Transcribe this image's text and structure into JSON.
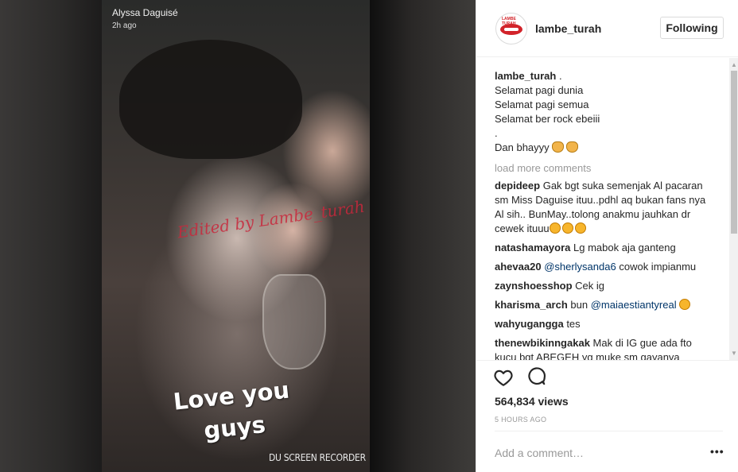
{
  "media": {
    "story_username": "Alyssa Daguisé",
    "story_time": "2h ago",
    "watermark": "Edited by Lambe_turah",
    "caption": "Love you guys",
    "recorder_label": "DU SCREEN RECORDER"
  },
  "header": {
    "avatar_brand": "LAMBE TURAH",
    "username": "lambe_turah",
    "follow_label": "Following"
  },
  "caption": {
    "username": "lambe_turah",
    "first_line": ".",
    "lines": [
      "Selamat pagi dunia",
      "Selamat pagi semua",
      "Selamat ber rock ebeiii",
      "."
    ],
    "last_line": "Dan bhayyy"
  },
  "load_more": "load more comments",
  "comments": [
    {
      "user": "depideep",
      "mention": "",
      "text": "Gak bgt suka semenjak Al pacaran sm Miss Daguise ituu..pdhl aq bukan fans nya Al sih.. BunMay..tolong anakmu jauhkan dr cewek ituuu"
    },
    {
      "user": "natashamayora",
      "mention": "",
      "text": "Lg mabok aja ganteng"
    },
    {
      "user": "ahevaa20",
      "mention": "@sherlysanda6",
      "text": "cowok impianmu"
    },
    {
      "user": "zaynshoesshop",
      "mention": "",
      "text": "Cek ig"
    },
    {
      "user": "kharisma_arch",
      "mention": "@maiaestiantyreal",
      "text": "bun"
    },
    {
      "user": "wahyugangga",
      "mention": "",
      "text": "tes"
    },
    {
      "user": "thenewbikinngakak",
      "mention": "",
      "text": "Mak di IG gue ada fto kucu bgt ABEGEH yg muke sm gayanya"
    }
  ],
  "stats": {
    "views": "564,834 views",
    "posted": "5 HOURS AGO"
  },
  "input": {
    "placeholder": "Add a comment…",
    "more": "•••"
  }
}
